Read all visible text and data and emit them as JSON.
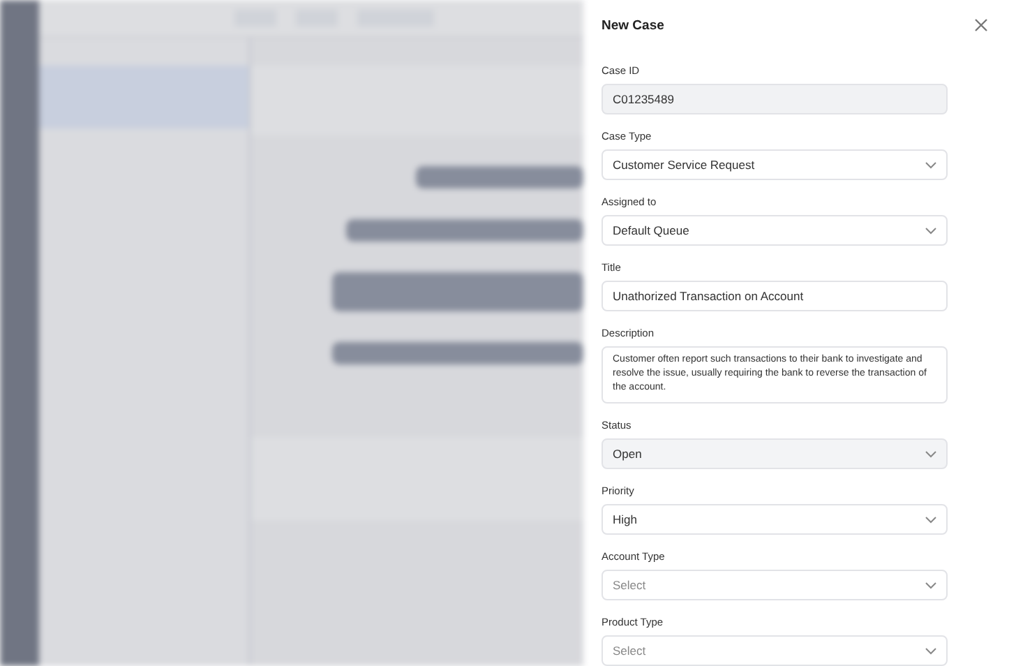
{
  "panel": {
    "title": "New Case",
    "fields": [
      {
        "label": "Case ID",
        "kind": "text",
        "value": "C01235489",
        "readonly": true,
        "hovered": false
      },
      {
        "label": "Case Type",
        "kind": "select",
        "value": "Customer Service Request",
        "readonly": false,
        "hovered": false
      },
      {
        "label": "Assigned to",
        "kind": "select",
        "value": "Default Queue",
        "readonly": false,
        "hovered": false
      },
      {
        "label": "Title",
        "kind": "text",
        "value": "Unathorized Transaction on Account",
        "readonly": false,
        "hovered": false
      },
      {
        "label": "Description",
        "kind": "textarea",
        "value": "Customer often report such transactions to their bank to investigate and resolve the issue, usually requiring the bank to reverse the transaction of the account.",
        "readonly": false,
        "hovered": false
      },
      {
        "label": "Status",
        "kind": "select",
        "value": "Open",
        "readonly": false,
        "hovered": true
      },
      {
        "label": "Priority",
        "kind": "select",
        "value": "High",
        "readonly": false,
        "hovered": false
      },
      {
        "label": "Account Type",
        "kind": "select",
        "placeholder": "Select",
        "readonly": false,
        "hovered": false
      },
      {
        "label": "Product Type",
        "kind": "select",
        "placeholder": "Select",
        "readonly": false,
        "hovered": false
      }
    ]
  }
}
